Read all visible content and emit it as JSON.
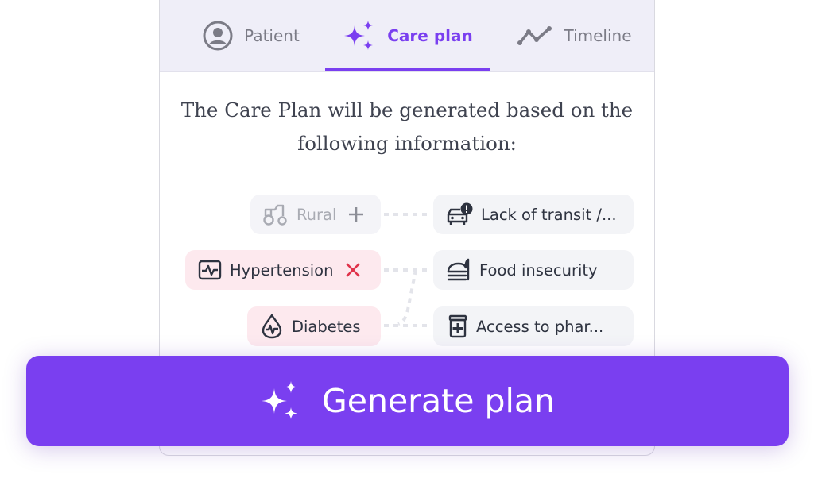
{
  "tabs": [
    {
      "label": "Patient",
      "icon": "user-circle-icon",
      "active": false
    },
    {
      "label": "Care plan",
      "icon": "sparkles-icon",
      "active": true
    },
    {
      "label": "Timeline",
      "icon": "trend-line-icon",
      "active": false
    }
  ],
  "intro": {
    "line1": "The Care Plan will be generated based on the",
    "line2": "following information:"
  },
  "factors": {
    "left": [
      {
        "label": "Rural",
        "icon": "tractor-icon",
        "action": "plus-icon",
        "state": "excluded"
      },
      {
        "label": "Hypertension",
        "icon": "heart-monitor-icon",
        "action": "close-icon",
        "state": "included"
      },
      {
        "label": "Diabetes",
        "icon": "blood-drop-icon",
        "action": "",
        "state": "included"
      }
    ],
    "right": [
      {
        "label": "Lack of transit /...",
        "icon": "car-alert-icon"
      },
      {
        "label": "Food insecurity",
        "icon": "food-icon"
      },
      {
        "label": "Access to phar...",
        "icon": "medicine-bottle-icon"
      }
    ]
  },
  "generate_button": {
    "label": "Generate plan",
    "icon": "sparkles-icon"
  },
  "colors": {
    "accent": "#7a3ff0",
    "tab_bar": "#efeef8",
    "included_chip": "#fde9ee",
    "remove_x": "#e0334a"
  }
}
